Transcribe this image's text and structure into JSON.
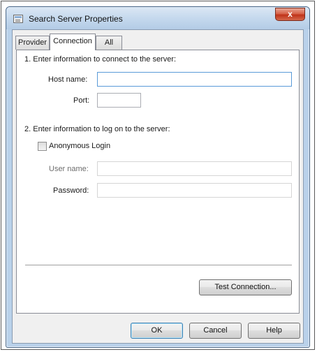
{
  "window": {
    "title": "Search Server Properties",
    "close_label": "x"
  },
  "tabs": [
    {
      "label": "Provider",
      "active": false
    },
    {
      "label": "Connection",
      "active": true
    },
    {
      "label": "All",
      "active": false
    }
  ],
  "connection": {
    "section1_heading": "1. Enter information to connect to the server:",
    "host_label": "Host name:",
    "host_value": "",
    "port_label": "Port:",
    "port_value": "",
    "section2_heading": "2. Enter information to log on to the server:",
    "anonymous_label": "Anonymous Login",
    "anonymous_checked": false,
    "user_label": "User name:",
    "user_value": "",
    "password_label": "Password:",
    "password_value": "",
    "test_button": "Test Connection..."
  },
  "footer": {
    "ok_label": "OK",
    "cancel_label": "Cancel",
    "help_label": "Help"
  }
}
